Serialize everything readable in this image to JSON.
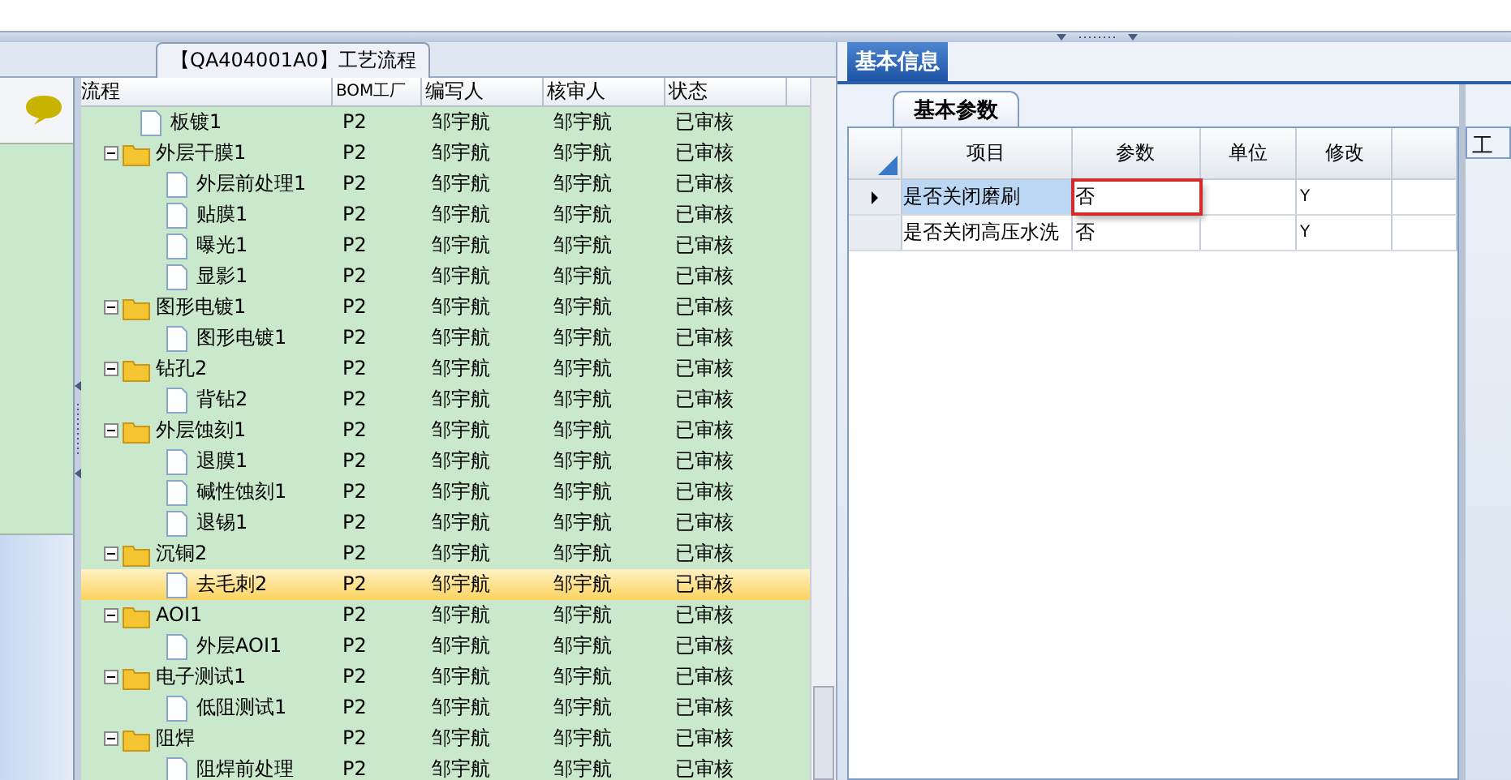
{
  "flow_panel": {
    "title": "【QA404001A0】工艺流程"
  },
  "tree": {
    "columns": [
      "流程",
      "BOM工厂",
      "编写人",
      "核审人",
      "状态"
    ],
    "nodes": [
      {
        "kind": "file",
        "label": "板镀1",
        "bom": "P2",
        "writer": "邹宇航",
        "reviewer": "邹宇航",
        "status": "已审核",
        "selected": false
      },
      {
        "kind": "folder",
        "label": "外层干膜1",
        "bom": "P2",
        "writer": "邹宇航",
        "reviewer": "邹宇航",
        "status": "已审核",
        "selected": false,
        "expanded": true,
        "children": [
          {
            "kind": "file",
            "label": "外层前处理1",
            "bom": "P2",
            "writer": "邹宇航",
            "reviewer": "邹宇航",
            "status": "已审核",
            "selected": false
          },
          {
            "kind": "file",
            "label": "贴膜1",
            "bom": "P2",
            "writer": "邹宇航",
            "reviewer": "邹宇航",
            "status": "已审核",
            "selected": false
          },
          {
            "kind": "file",
            "label": "曝光1",
            "bom": "P2",
            "writer": "邹宇航",
            "reviewer": "邹宇航",
            "status": "已审核",
            "selected": false
          },
          {
            "kind": "file",
            "label": "显影1",
            "bom": "P2",
            "writer": "邹宇航",
            "reviewer": "邹宇航",
            "status": "已审核",
            "selected": false
          }
        ]
      },
      {
        "kind": "folder",
        "label": "图形电镀1",
        "bom": "P2",
        "writer": "邹宇航",
        "reviewer": "邹宇航",
        "status": "已审核",
        "selected": false,
        "expanded": true,
        "children": [
          {
            "kind": "file",
            "label": "图形电镀1",
            "bom": "P2",
            "writer": "邹宇航",
            "reviewer": "邹宇航",
            "status": "已审核",
            "selected": false
          }
        ]
      },
      {
        "kind": "folder",
        "label": "钻孔2",
        "bom": "P2",
        "writer": "邹宇航",
        "reviewer": "邹宇航",
        "status": "已审核",
        "selected": false,
        "expanded": true,
        "children": [
          {
            "kind": "file",
            "label": "背钻2",
            "bom": "P2",
            "writer": "邹宇航",
            "reviewer": "邹宇航",
            "status": "已审核",
            "selected": false
          }
        ]
      },
      {
        "kind": "folder",
        "label": "外层蚀刻1",
        "bom": "P2",
        "writer": "邹宇航",
        "reviewer": "邹宇航",
        "status": "已审核",
        "selected": false,
        "expanded": true,
        "children": [
          {
            "kind": "file",
            "label": "退膜1",
            "bom": "P2",
            "writer": "邹宇航",
            "reviewer": "邹宇航",
            "status": "已审核",
            "selected": false
          },
          {
            "kind": "file",
            "label": "碱性蚀刻1",
            "bom": "P2",
            "writer": "邹宇航",
            "reviewer": "邹宇航",
            "status": "已审核",
            "selected": false
          },
          {
            "kind": "file",
            "label": "退锡1",
            "bom": "P2",
            "writer": "邹宇航",
            "reviewer": "邹宇航",
            "status": "已审核",
            "selected": false
          }
        ]
      },
      {
        "kind": "folder",
        "label": "沉铜2",
        "bom": "P2",
        "writer": "邹宇航",
        "reviewer": "邹宇航",
        "status": "已审核",
        "selected": false,
        "expanded": true,
        "children": [
          {
            "kind": "file",
            "label": "去毛刺2",
            "bom": "P2",
            "writer": "邹宇航",
            "reviewer": "邹宇航",
            "status": "已审核",
            "selected": true
          }
        ]
      },
      {
        "kind": "folder",
        "label": "AOI1",
        "bom": "P2",
        "writer": "邹宇航",
        "reviewer": "邹宇航",
        "status": "已审核",
        "selected": false,
        "expanded": true,
        "children": [
          {
            "kind": "file",
            "label": "外层AOI1",
            "bom": "P2",
            "writer": "邹宇航",
            "reviewer": "邹宇航",
            "status": "已审核",
            "selected": false
          }
        ]
      },
      {
        "kind": "folder",
        "label": "电子测试1",
        "bom": "P2",
        "writer": "邹宇航",
        "reviewer": "邹宇航",
        "status": "已审核",
        "selected": false,
        "expanded": true,
        "children": [
          {
            "kind": "file",
            "label": "低阻测试1",
            "bom": "P2",
            "writer": "邹宇航",
            "reviewer": "邹宇航",
            "status": "已审核",
            "selected": false
          }
        ]
      },
      {
        "kind": "folder",
        "label": "阻焊",
        "bom": "P2",
        "writer": "邹宇航",
        "reviewer": "邹宇航",
        "status": "已审核",
        "selected": false,
        "expanded": true,
        "children": [
          {
            "kind": "file",
            "label": "阻焊前处理",
            "bom": "P2",
            "writer": "邹宇航",
            "reviewer": "邹宇航",
            "status": "已审核",
            "selected": false
          }
        ]
      }
    ]
  },
  "tabs": [
    {
      "label": "基本信息",
      "selected": true
    }
  ],
  "sub_tabs": [
    {
      "label": "基本参数",
      "selected": true
    }
  ],
  "params": {
    "columns": [
      "项目",
      "参数",
      "单位",
      "修改"
    ],
    "rows": [
      {
        "item": "是否关闭磨刷",
        "value": "否",
        "modify": "Y",
        "selected": true,
        "highlighted": true
      },
      {
        "item": "是否关闭高压水洗",
        "value": "否",
        "modify": "Y",
        "selected": false,
        "highlighted": false
      }
    ]
  },
  "side_panel": {
    "title": "工"
  }
}
